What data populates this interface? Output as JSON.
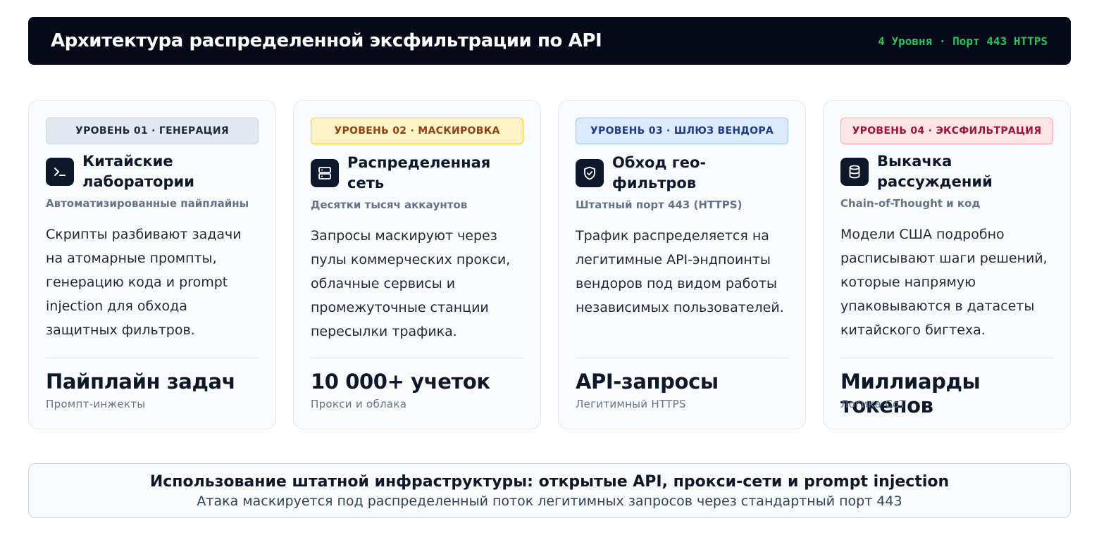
{
  "header": {
    "title": "Архитектура распределенной эксфильтрации по API",
    "meta": "4 Уровня · Порт 443 HTTPS"
  },
  "cards": [
    {
      "badge": "УРОВЕНЬ 01 · ГЕНЕРАЦИЯ",
      "icon": "terminal-icon",
      "title": "Китайские лаборатории",
      "subtitle": "Автоматизированные пайплайны",
      "description": "Скрипты разбивают задачи на атомарные промпты, генерацию кода и prompt injection для обхода защитных фильтров.",
      "metric": "Пайплайн задач",
      "metric_sub": "Промпт-инжекты"
    },
    {
      "badge": "УРОВЕНЬ 02 · МАСКИРОВКА",
      "icon": "server-icon",
      "title": "Распределенная сеть",
      "subtitle": "Десятки тысяч аккаунтов",
      "description": "Запросы маскируют через пулы коммерческих прокси, облачные сервисы и промежуточные станции пересылки трафика.",
      "metric": "10 000+ учеток",
      "metric_sub": "Прокси и облака"
    },
    {
      "badge": "УРОВЕНЬ 03 · ШЛЮЗ ВЕНДОРА",
      "icon": "shield-icon",
      "title": "Обход гео-фильтров",
      "subtitle": "Штатный порт 443 (HTTPS)",
      "description": "Трафик распределяется на легитимные API-эндпоинты вендоров под видом работы независимых пользователей.",
      "metric": "API-запросы",
      "metric_sub": "Легитимный HTTPS"
    },
    {
      "badge": "УРОВЕНЬ 04 · ЭКСФИЛЬТРАЦИЯ",
      "icon": "database-icon",
      "title": "Выкачка рассуждений",
      "subtitle": "Chain-of-Thought и код",
      "description": "Модели США подробно расписывают шаги решений, которые напрямую упаковываются в датасеты китайского бигтеха.",
      "metric": "Миллиарды токенов",
      "metric_sub": "Логика CoT"
    }
  ],
  "footer": {
    "title": "Использование штатной инфраструктуры: открытые API, прокси-сети и prompt injection",
    "subtitle": "Атака маскируется под распределенный поток легитимных запросов через стандартный порт 443"
  },
  "colors": {
    "header_bg": "#060a18",
    "accent_green": "#22c55e",
    "level1": "#e2e8f0",
    "level2": "#fef3c7",
    "level3": "#dbeafe",
    "level4": "#ffe4e6"
  }
}
